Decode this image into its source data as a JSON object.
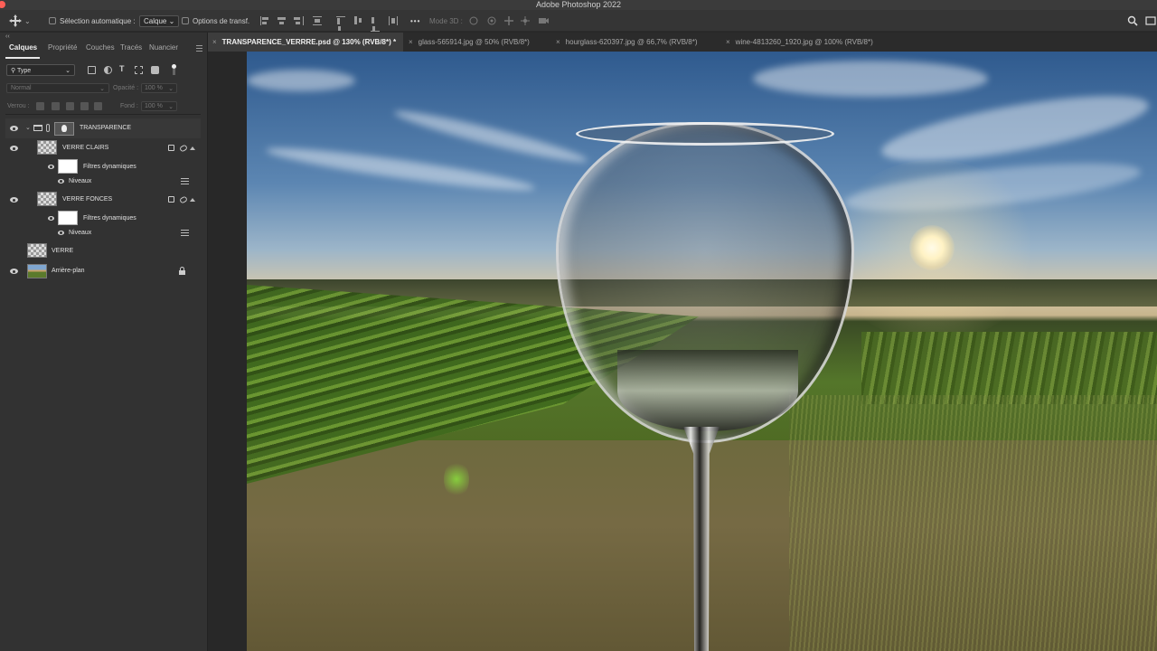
{
  "app": {
    "title": "Adobe Photoshop 2022"
  },
  "options_bar": {
    "auto_select_label": "Sélection automatique :",
    "auto_select_value": "Calque",
    "transform_options_label": "Options de transf.",
    "mode_3d_label": "Mode 3D :",
    "more_label": "•••"
  },
  "doc_tabs": [
    {
      "label": "TRANSPARENCE_VERRRE.psd @ 130% (RVB/8*) *",
      "active": true
    },
    {
      "label": "glass-565914.jpg @ 50% (RVB/8*)",
      "active": false
    },
    {
      "label": "hourglass-620397.jpg @ 66,7% (RVB/8*)",
      "active": false
    },
    {
      "label": "wine-4813260_1920.jpg @ 100% (RVB/8*)",
      "active": false
    }
  ],
  "panel": {
    "collapse_label": "‹‹",
    "tabs": [
      "Calques",
      "Propriété",
      "Couches",
      "Tracés",
      "Nuancier"
    ],
    "filter_label": "Type",
    "blend_mode": "Normal",
    "opacity_label": "Opacité :",
    "opacity_value": "100 %",
    "lock_label": "Verrou :",
    "fill_label": "Fond :",
    "fill_value": "100 %"
  },
  "layers": [
    {
      "name": "TRANSPARENCE",
      "kind": "group",
      "visible": true
    },
    {
      "name": "VERRE CLAIRS",
      "kind": "smart",
      "visible": true
    },
    {
      "name": "Filtres dynamiques",
      "kind": "filter-mask",
      "visible": true
    },
    {
      "name": "Niveaux",
      "kind": "filter",
      "visible": true
    },
    {
      "name": "VERRE FONCES",
      "kind": "smart",
      "visible": true
    },
    {
      "name": "Filtres dynamiques",
      "kind": "filter-mask",
      "visible": true
    },
    {
      "name": "Niveaux",
      "kind": "filter",
      "visible": true
    },
    {
      "name": "VERRE",
      "kind": "smart",
      "visible": false
    },
    {
      "name": "Arrière-plan",
      "kind": "background",
      "visible": true,
      "locked": true
    }
  ],
  "colors": {
    "titlebar": "#3b3b3b",
    "panel_bg": "#323232",
    "traffic_red": "#fe5f57",
    "traffic_yellow": "#febc2e",
    "traffic_green": "#28c840"
  }
}
